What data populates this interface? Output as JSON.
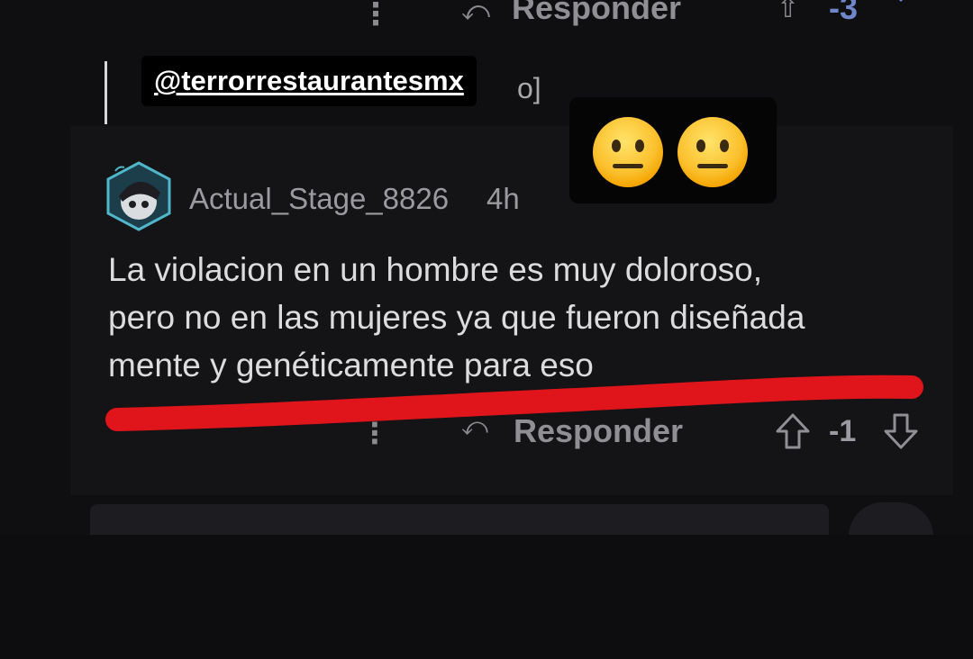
{
  "previous_comment": {
    "reply_label": "Responder",
    "score": "-3",
    "quote_tail": "o]"
  },
  "sticker": {
    "mention": "@terrorrestaurantesmx",
    "emoji": [
      "neutral-face",
      "neutral-face"
    ]
  },
  "comment": {
    "username": "Actual_Stage_8826",
    "time": "4h",
    "body_lines": [
      "La violacion en un hombre es muy doloroso,",
      "pero no en las mujeres ya que fueron diseñada",
      "mente y genéticamente para eso"
    ],
    "reply_label": "Responder",
    "score": "-1"
  },
  "colors": {
    "background": "#0f0e10",
    "text": "#dcdcdf",
    "muted": "#9b9b9f",
    "highlight_stroke": "#e0141b",
    "downvote_active": "#6f86c9"
  }
}
